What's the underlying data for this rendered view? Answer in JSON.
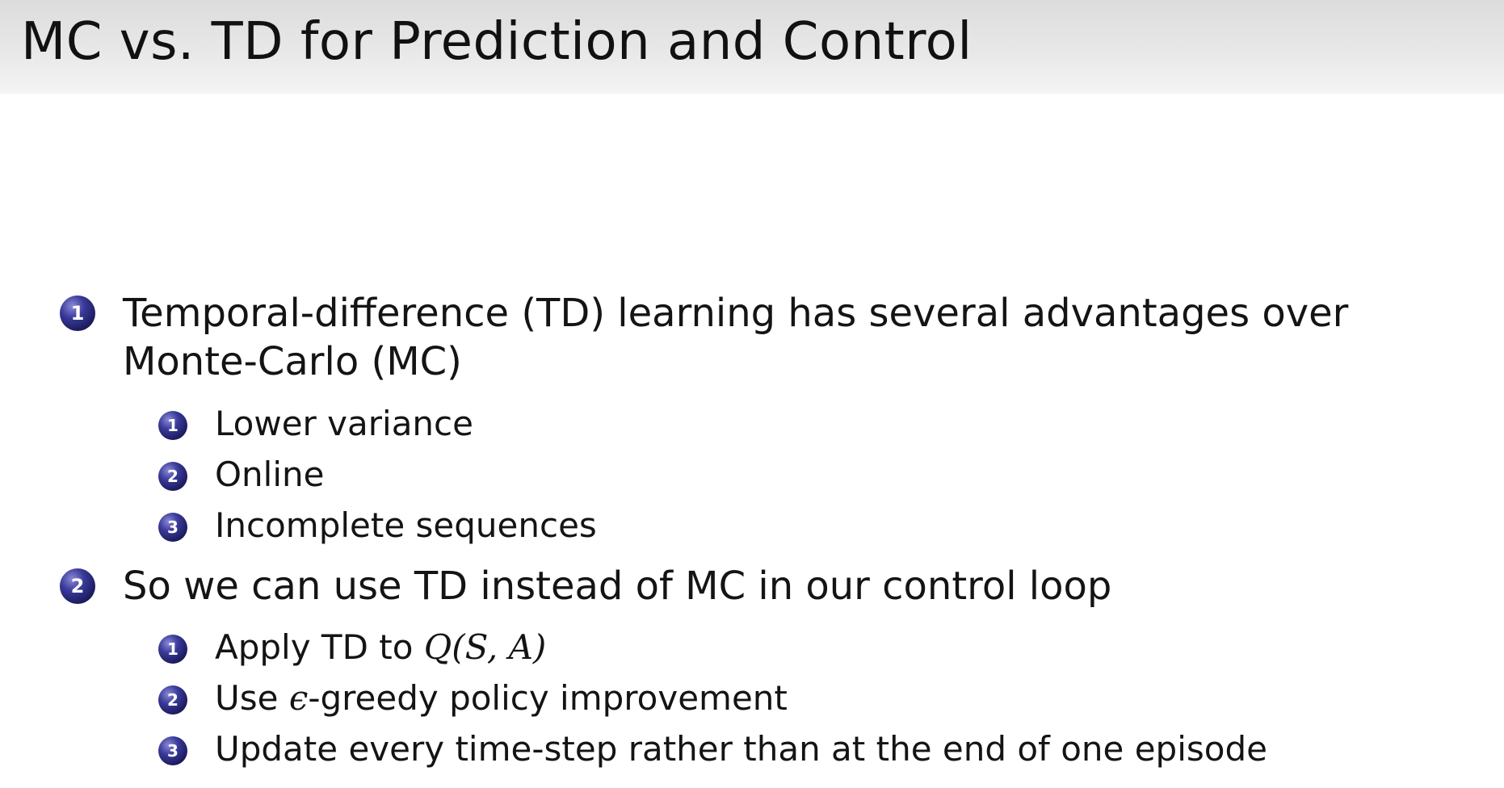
{
  "slide": {
    "title": "MC vs. TD for Prediction and Control"
  },
  "items": [
    {
      "number": "1",
      "text_line1": "Temporal-difference (TD) learning has several advantages over",
      "text_line2": "Monte-Carlo (MC)",
      "subitems": [
        {
          "number": "1",
          "text": "Lower variance"
        },
        {
          "number": "2",
          "text": "Online"
        },
        {
          "number": "3",
          "text": "Incomplete sequences"
        }
      ]
    },
    {
      "number": "2",
      "text": "So we can use TD instead of MC in our control loop",
      "subitems": [
        {
          "number": "1",
          "text_prefix": "Apply TD to ",
          "math": "Q(S, A)"
        },
        {
          "number": "2",
          "text_prefix": "Use ",
          "math": "ϵ",
          "text_suffix": "-greedy policy improvement"
        },
        {
          "number": "3",
          "text": "Update every time-step rather than at the end of one episode"
        }
      ]
    }
  ]
}
